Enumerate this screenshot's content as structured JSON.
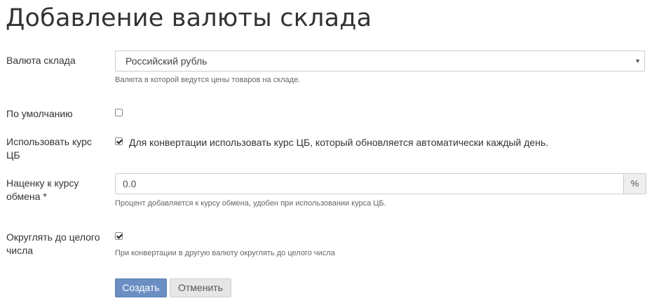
{
  "page": {
    "title": "Добавление валюты склада"
  },
  "form": {
    "currency": {
      "label": "Валюта склада",
      "value": "Российский рубль",
      "help": "Валюта в которой ведутся цены товаров на складе."
    },
    "default": {
      "label": "По умолчанию",
      "checked": false
    },
    "use_cb_rate": {
      "label": "Использовать курс ЦБ",
      "checked": true,
      "text": "Для конвертации использовать курс ЦБ, который обновляется автоматически каждый день."
    },
    "markup": {
      "label": "Наценку к курсу обмена *",
      "value": "0.0",
      "addon": "%",
      "help": "Процент добавляется к курсу обмена, удобен при использовании курса ЦБ."
    },
    "round": {
      "label": "Округлять до целого числа",
      "checked": true,
      "help": "При конвертации в другую валюту округлять до целого числа"
    }
  },
  "actions": {
    "create_label": "Создать",
    "cancel_label": "Отменить"
  }
}
